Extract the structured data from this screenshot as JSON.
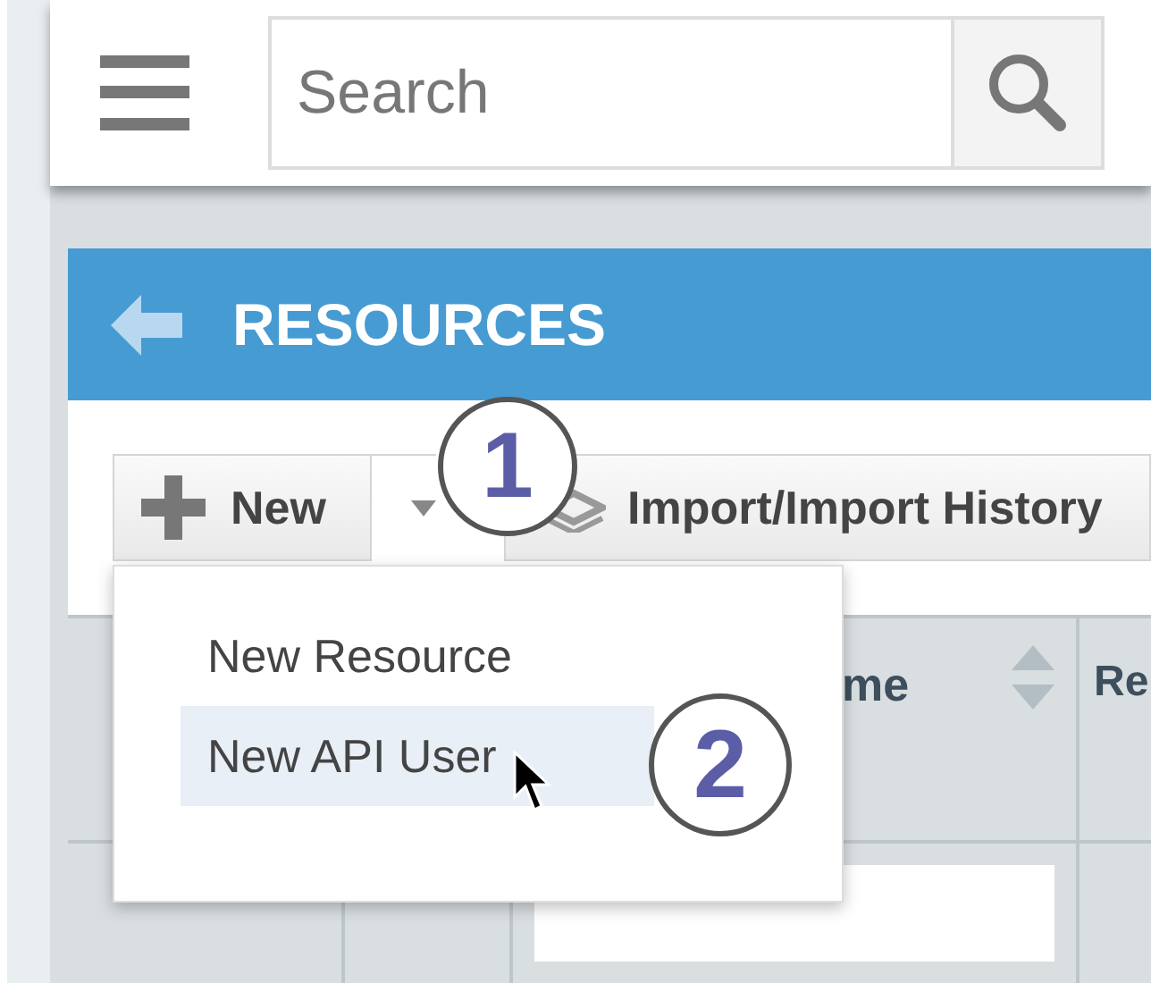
{
  "header": {
    "search": {
      "placeholder": "Search"
    }
  },
  "page": {
    "title": "RESOURCES"
  },
  "toolbar": {
    "new_button": "New",
    "import_button": "Import/Import History"
  },
  "menu": {
    "items": [
      {
        "label": "New Resource",
        "selected": false
      },
      {
        "label": "New API User",
        "selected": true
      }
    ]
  },
  "table": {
    "columns": [
      {
        "label": "me",
        "sortable": true
      },
      {
        "label": "Re"
      }
    ]
  },
  "callouts": [
    "1",
    "2"
  ]
}
